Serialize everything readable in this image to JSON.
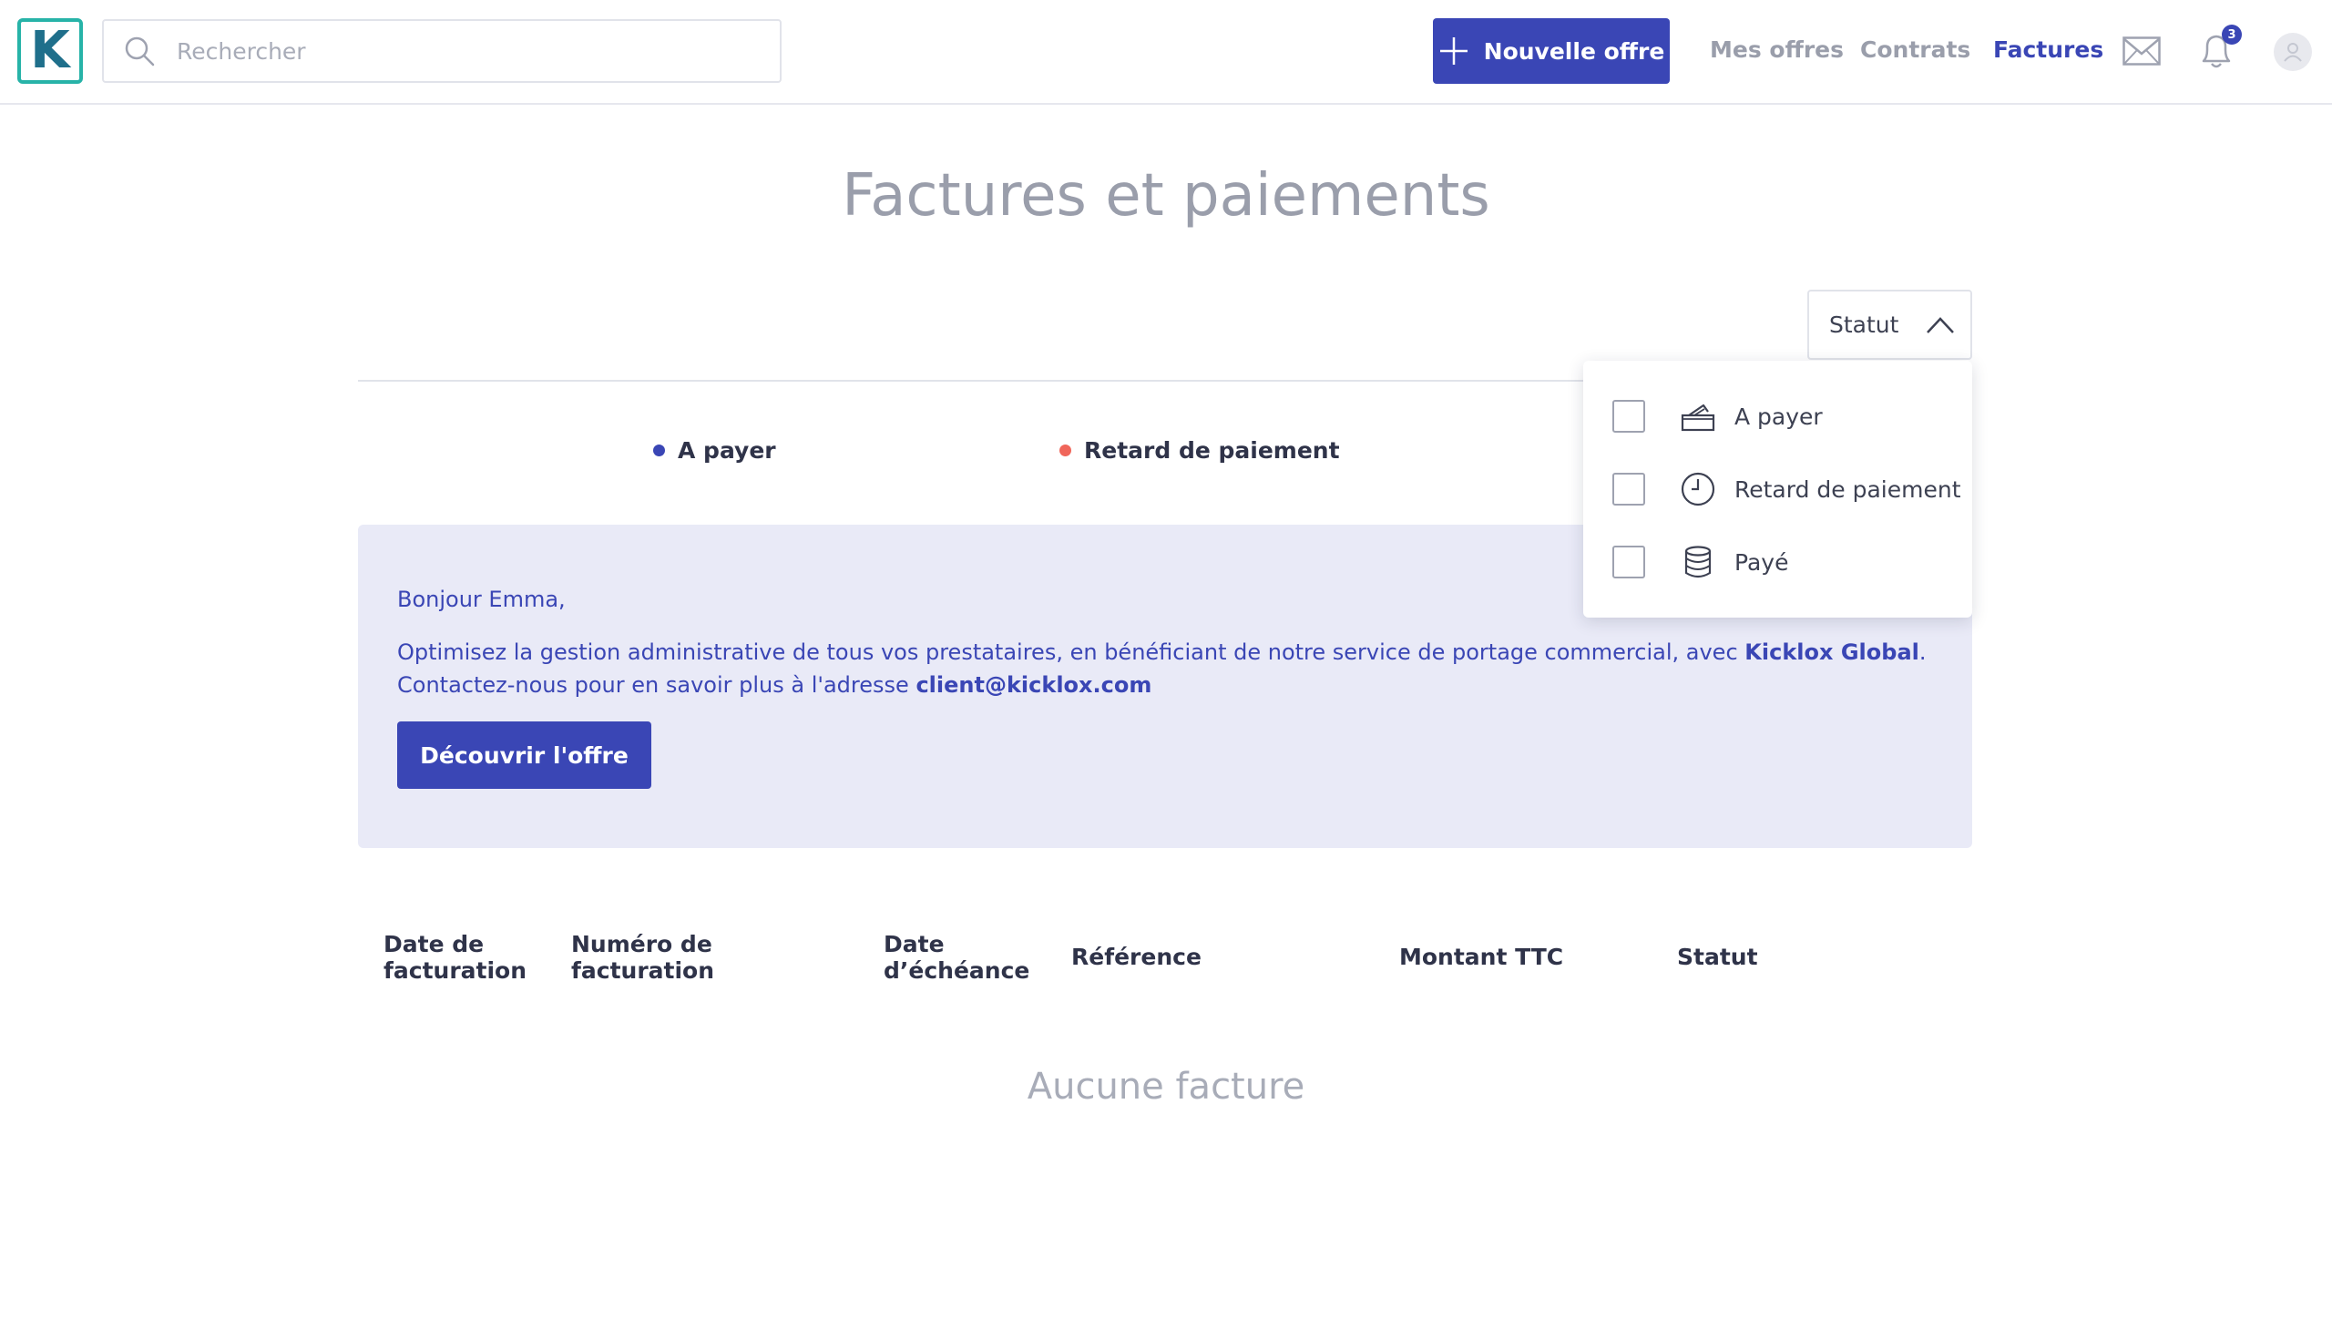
{
  "header": {
    "logo_letter": "K",
    "search_placeholder": "Rechercher",
    "new_offer_label": "Nouvelle offre",
    "nav": [
      "Mes offres",
      "Contrats",
      "Factures"
    ],
    "notification_count": "3"
  },
  "page": {
    "title": "Factures et paiements"
  },
  "filter": {
    "status_label": "Statut",
    "options": [
      "A payer",
      "Retard de paiement",
      "Payé"
    ]
  },
  "legend": [
    {
      "label": "A payer",
      "color": "#3a46b5"
    },
    {
      "label": "Retard de paiement",
      "color": "#f0665a"
    }
  ],
  "banner": {
    "greeting": "Bonjour Emma,",
    "line1_text": "Optimisez la gestion administrative de tous vos prestataires, en bénéficiant de notre service de portage commercial, avec ",
    "line1_link": "Kicklox Global",
    "line1_end": ".",
    "line2_text": "Contactez-nous pour en savoir plus à l'adresse ",
    "line2_email": "client@kicklox.com",
    "button_label": "Découvrir l'offre"
  },
  "table": {
    "columns": [
      {
        "line1": "Date de",
        "line2": "facturation"
      },
      {
        "line1": "Numéro de",
        "line2": "facturation"
      },
      {
        "line1": "Date",
        "line2": "d’échéance"
      },
      {
        "line1": "Référence",
        "line2": ""
      },
      {
        "line1": "Montant TTC",
        "line2": ""
      },
      {
        "line1": "Statut",
        "line2": ""
      }
    ],
    "empty_message": "Aucune facture"
  },
  "colors": {
    "primary": "#3a46b5",
    "late": "#f0665a",
    "muted": "#9a9eab",
    "banner_bg": "#e9eaf7"
  }
}
